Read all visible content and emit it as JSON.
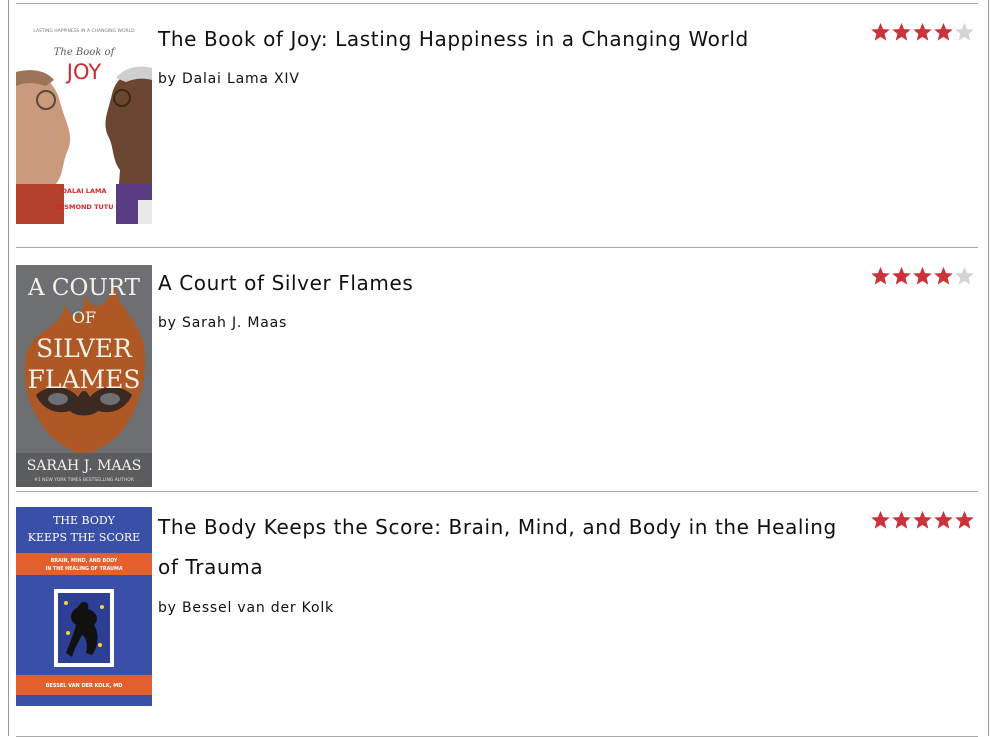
{
  "books": [
    {
      "title": "The Book of Joy: Lasting Happiness in a Changing World",
      "author": "by Dalai Lama XIV",
      "rating": 4,
      "max_rating": 5,
      "cover": {
        "kicker": "LASTING HAPPINESS IN A CHANGING WORLD",
        "line1": "The Book of",
        "line2": "JOY",
        "credit1": "DALAI LAMA",
        "credit2": "DESMOND TUTU"
      }
    },
    {
      "title": "A Court of Silver Flames",
      "author": "by Sarah J. Maas",
      "rating": 4,
      "max_rating": 5,
      "cover": {
        "line1": "A COURT",
        "line2": "OF",
        "line3": "SILVER",
        "line4": "FLAMES",
        "credit": "SARAH J. MAAS",
        "tagline": "#1 NEW YORK TIMES BESTSELLING AUTHOR"
      }
    },
    {
      "title": "The Body Keeps the Score: Brain, Mind, and Body in the Healing of Trauma",
      "author": "by Bessel van der Kolk",
      "rating": 5,
      "max_rating": 5,
      "cover": {
        "line1": "THE BODY",
        "line2": "KEEPS THE SCORE",
        "subtitle1": "BRAIN, MIND, AND BODY",
        "subtitle2": "IN THE HEALING OF TRAUMA",
        "credit": "BESSEL VAN DER KOLK, MD"
      }
    }
  ],
  "colors": {
    "star_filled": "#c8343a",
    "star_empty": "#d4d4d4",
    "divider": "#a8a8a8",
    "joy_red": "#d3282c",
    "flames_gray": "#6d6f72",
    "flames_orange": "#c0581f",
    "body_blue": "#3a4fa7",
    "body_orange": "#e3602e"
  }
}
